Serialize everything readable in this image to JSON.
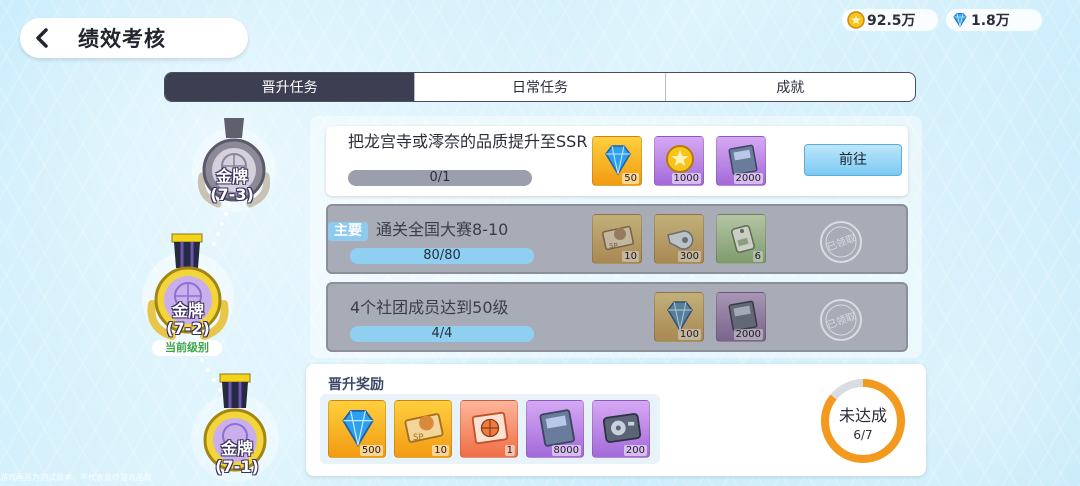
{
  "header": {
    "back_icon": "chevron-left-icon",
    "title": "绩效考核"
  },
  "currencies": [
    {
      "icon": "gold-coin-icon",
      "value": "92.5万"
    },
    {
      "icon": "diamond-icon",
      "value": "1.8万"
    }
  ],
  "tabs": [
    {
      "label": "晋升任务",
      "active": true
    },
    {
      "label": "日常任务",
      "active": false
    },
    {
      "label": "成就",
      "active": false
    }
  ],
  "timeline": {
    "medals": [
      {
        "label": "金牌\n(7-3)",
        "state": "locked"
      },
      {
        "label": "金牌\n(7-2)",
        "state": "current"
      },
      {
        "label": "金牌\n(7-1)",
        "state": "passed"
      }
    ],
    "current_tag": "当前级别"
  },
  "tasks": [
    {
      "title": "把龙宫寺或澪奈的品质提升至SSR",
      "main": false,
      "progress_text": "0/1",
      "progress_fraction": 0,
      "status": "open",
      "button_label": "前往",
      "rewards": [
        {
          "icon": "diamond-icon",
          "quality": "orange",
          "count": "50"
        },
        {
          "icon": "coin-icon",
          "quality": "purple",
          "count": "1000"
        },
        {
          "icon": "card-icon",
          "quality": "purple",
          "count": "2000"
        }
      ]
    },
    {
      "title": "通关全国大赛8-10",
      "main": true,
      "main_tag": "主要",
      "progress_text": "80/80",
      "progress_fraction": 1,
      "status": "claimed",
      "stamp_text": "已领取",
      "rewards": [
        {
          "icon": "sp-ticket-icon",
          "quality": "orange",
          "count": "10"
        },
        {
          "icon": "whistle-icon",
          "quality": "orange",
          "count": "300"
        },
        {
          "icon": "tag-icon",
          "quality": "green",
          "count": "6"
        }
      ]
    },
    {
      "title": "4个社团成员达到50级",
      "main": false,
      "progress_text": "4/4",
      "progress_fraction": 1,
      "status": "claimed",
      "stamp_text": "已领取",
      "rewards": [
        {
          "icon": "diamond-icon",
          "quality": "orange",
          "count": "100"
        },
        {
          "icon": "card-icon",
          "quality": "purple",
          "count": "2000"
        }
      ]
    }
  ],
  "promotion_rewards": {
    "title": "晋升奖励",
    "items": [
      {
        "icon": "diamond-icon",
        "quality": "orange",
        "count": "500"
      },
      {
        "icon": "sp-ticket-icon",
        "quality": "orange",
        "count": "10"
      },
      {
        "icon": "basketball-ticket-icon",
        "quality": "red",
        "count": "1"
      },
      {
        "icon": "card-icon",
        "quality": "purple",
        "count": "8000"
      },
      {
        "icon": "hard-drive-icon",
        "quality": "purple",
        "count": "200"
      }
    ],
    "status_text": "未达成",
    "progress_text": "6/7",
    "progress_fraction": 0.857
  },
  "colors": {
    "accent_blue": "#8fd0f2",
    "dark_tab": "#3c3f52",
    "ring_orange": "#f39a1e"
  },
  "disclaimer": "游戏画面为测试版本，不代表最终游戏品质"
}
